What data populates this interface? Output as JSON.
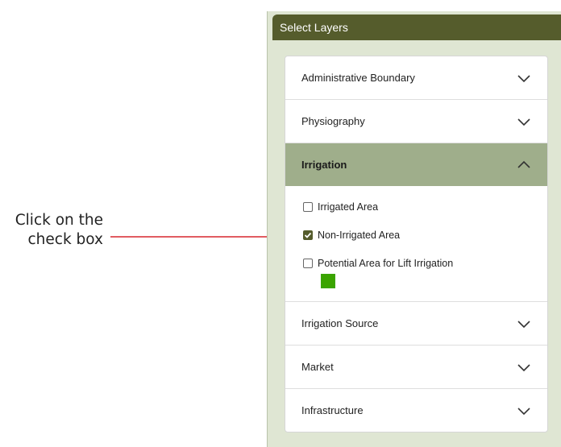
{
  "annotation": {
    "line1": "Click on the",
    "line2": "check box"
  },
  "panel": {
    "title": "Select Layers"
  },
  "accordion": {
    "items": [
      {
        "label": "Administrative Boundary",
        "icon": "chevron-down-icon"
      },
      {
        "label": "Physiography",
        "icon": "chevron-down-icon"
      },
      {
        "label": "Irrigation",
        "icon": "chevron-up-icon"
      },
      {
        "label": "Irrigation Source",
        "icon": "chevron-down-icon"
      },
      {
        "label": "Market",
        "icon": "chevron-down-icon"
      },
      {
        "label": "Infrastructure",
        "icon": "chevron-down-icon"
      }
    ],
    "irrigation_options": [
      {
        "label": "Irrigated Area",
        "checked": false
      },
      {
        "label": "Non-Irrigated Area",
        "checked": true
      },
      {
        "label": "Potential Area for Lift Irrigation",
        "checked": false
      }
    ],
    "legend_color": "#3aa400"
  },
  "colors": {
    "header": "#555c2c",
    "active_section": "#9fae8b",
    "panel_bg": "#dfe6d3",
    "arrow": "#d7262e"
  }
}
